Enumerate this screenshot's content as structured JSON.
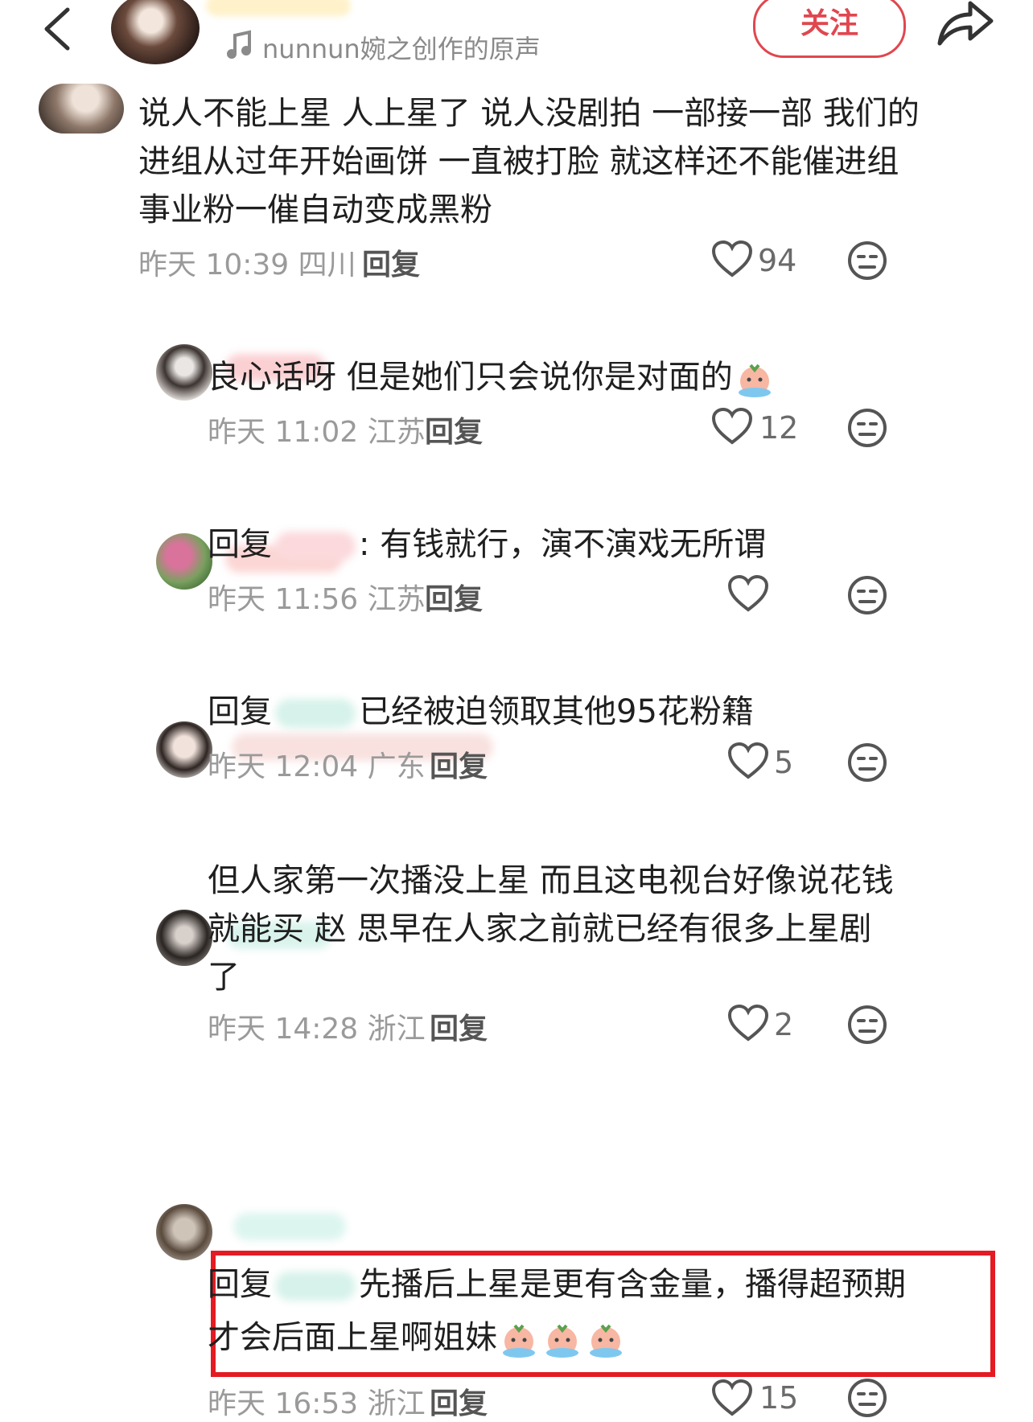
{
  "header": {
    "music_text": "nunnun婉之创作的原声",
    "follow_label": "关注"
  },
  "colors": {
    "accent": "#e0474f",
    "highlight_box": "#e41b23",
    "meta_gray": "#9a9a9a"
  },
  "comments": [
    {
      "text_lines": [
        "说人不能上星 人上星了 说人没剧拍 一部接一部 我们的",
        "进组从过年开始画饼 一直被打脸 就这样还不能催进组",
        "事业粉一催自动变成黑粉"
      ],
      "meta": "昨天 10:39 四川",
      "reply_label": "回复",
      "likes": "94"
    },
    {
      "text": "良心话呀 但是她们只会说你是对面的",
      "meta": "昨天 11:02 江苏",
      "reply_label": "回复",
      "likes": "12"
    },
    {
      "prefix": "回复",
      "text": ": 有钱就行，演不演戏无所谓",
      "meta": "昨天 11:56 江苏",
      "reply_label": "回复",
      "likes": ""
    },
    {
      "prefix": "回复",
      "text": "已经被迫领取其他95花粉籍",
      "meta": "昨天 12:04 广东",
      "reply_label": "回复",
      "likes": "5"
    },
    {
      "text_lines": [
        "但人家第一次播没上星 而且这电视台好像说花钱",
        "就能买 赵      思早在人家之前就已经有很多上星剧",
        "了"
      ],
      "meta": "昨天 14:28 浙江",
      "reply_label": "回复",
      "likes": "2"
    },
    {
      "prefix": "回复",
      "text_line1": "先播后上星是更有含金量，播得超预期",
      "text_line2": "才会后面上星啊姐妹",
      "meta": "昨天 16:53 浙江",
      "reply_label": "回复",
      "likes": "15"
    }
  ]
}
